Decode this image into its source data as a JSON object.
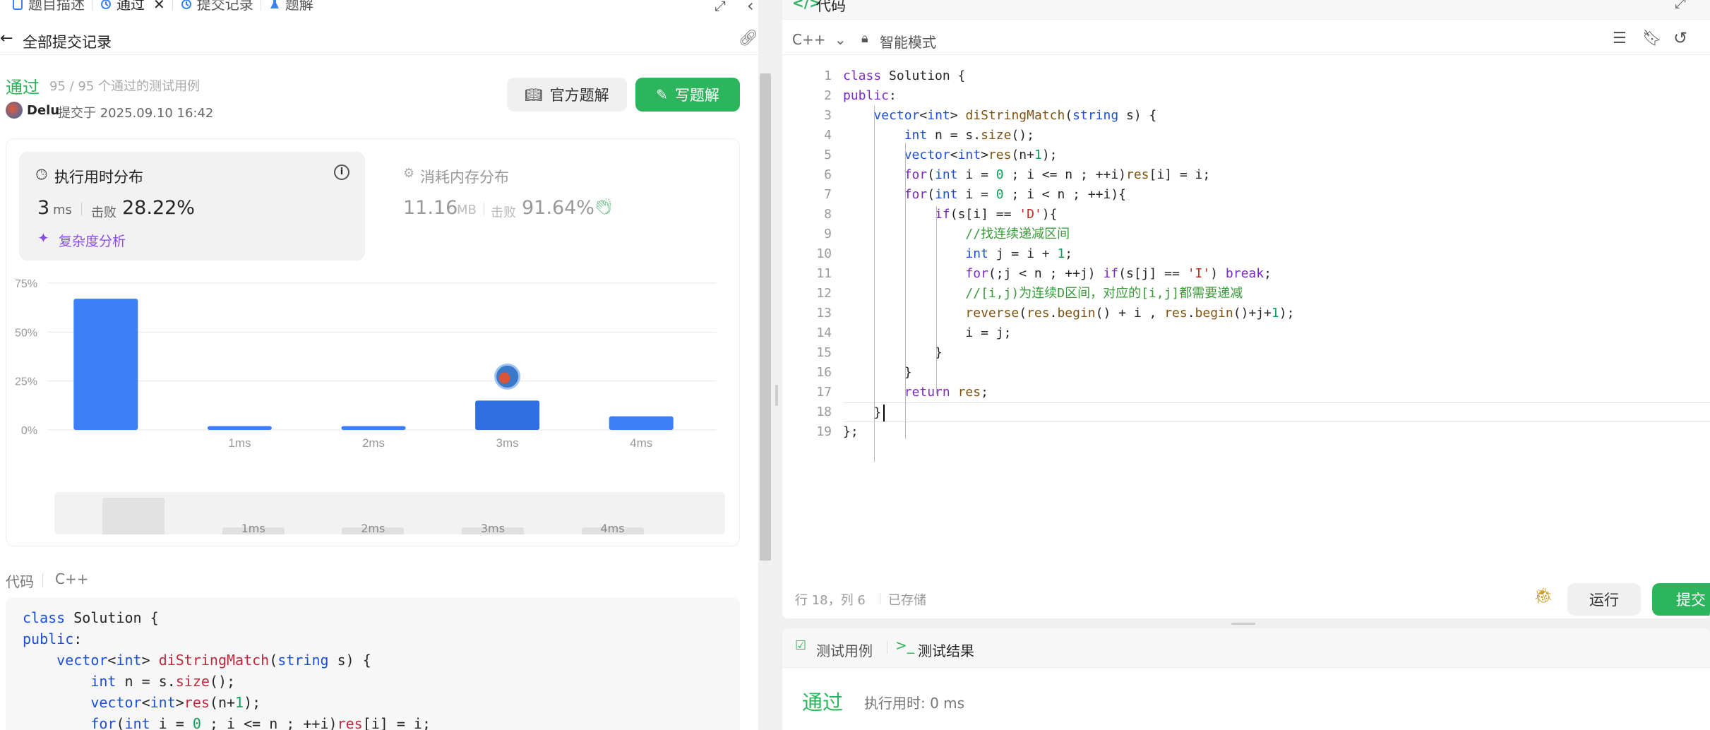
{
  "left": {
    "tabs": [
      {
        "label": "题目描述",
        "icon": "document-icon"
      },
      {
        "label": "通过",
        "icon": "history-icon",
        "closable": true
      },
      {
        "label": "提交记录",
        "icon": "history-icon"
      },
      {
        "label": "题解",
        "icon": "flask-icon"
      }
    ],
    "back_label": "全部提交记录",
    "status": "通过",
    "tests_passed": "95 / 95 个通过的测试用例",
    "user_name": "Delu",
    "submitted_at": "提交于 2025.09.10 16:42",
    "official_solution_label": "官方题解",
    "write_solution_label": "写题解",
    "runtime_card": {
      "title": "执行用时分布",
      "value": "3",
      "unit": "ms",
      "beats_label": "击败",
      "beats_value": "28.22%",
      "complexity_label": "复杂度分析"
    },
    "memory_card": {
      "title": "消耗内存分布",
      "value": "11.16",
      "unit": "MB",
      "beats_label": "击败",
      "beats_value": "91.64%"
    },
    "code_label": "代码",
    "code_lang": "C++",
    "code_preview": [
      "class Solution {",
      "public:",
      "    vector<int> diStringMatch(string s) {",
      "        int n = s.size();",
      "        vector<int>res(n+1);",
      "        for(int i = 0 ; i <= n ; ++i)res[i] = i;"
    ]
  },
  "chart_data": {
    "type": "bar",
    "categories": [
      "",
      "1ms",
      "2ms",
      "3ms",
      "4ms"
    ],
    "values": [
      67,
      2,
      2,
      15,
      7
    ],
    "ylim": [
      0,
      75
    ],
    "yticks": [
      "75%",
      "50%",
      "25%",
      "0%"
    ],
    "highlight_index": 3,
    "grid": true,
    "mini_labels": [
      "1ms",
      "2ms",
      "3ms",
      "4ms"
    ]
  },
  "right": {
    "header_label": "代码",
    "lang": "C++",
    "mode_label": "智能模式",
    "code_lines": [
      "class Solution {",
      "public:",
      "    vector<int> diStringMatch(string s) {",
      "        int n = s.size();",
      "        vector<int>res(n+1);",
      "        for(int i = 0 ; i <= n ; ++i)res[i] = i;",
      "        for(int i = 0 ; i < n ; ++i){",
      "            if(s[i] == 'D'){",
      "                //找连续递减区间",
      "                int j = i + 1;",
      "                for(;j < n ; ++j) if(s[j] == 'I') break;",
      "                //[i,j)为连续D区间，对应的[i,j]都需要递减",
      "                reverse(res.begin() + i , res.begin()+j+1);",
      "                i = j;",
      "            }",
      "        }",
      "        return res;",
      "    }",
      "};"
    ],
    "status_position": "行 18，列 6",
    "status_saved": "已存储",
    "run_label": "运行",
    "submit_label": "提交"
  },
  "bottom": {
    "tab_testcase": "测试用例",
    "tab_result": "测试结果",
    "result_status": "通过",
    "result_time": "执行用时: 0 ms"
  }
}
